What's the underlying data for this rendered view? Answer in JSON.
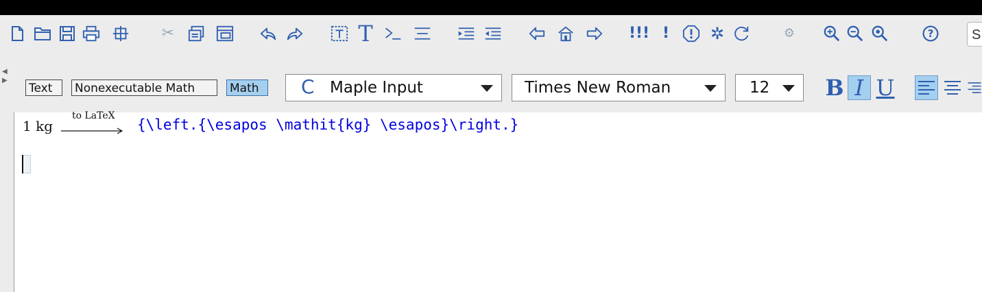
{
  "toolbar": {
    "icons": [
      {
        "name": "new-document-icon"
      },
      {
        "name": "open-folder-icon"
      },
      {
        "name": "save-icon"
      },
      {
        "name": "print-icon"
      },
      {
        "name": "print-preview-icon"
      },
      {
        "name": "cut-icon"
      },
      {
        "name": "copy-icon"
      },
      {
        "name": "paste-icon"
      },
      {
        "name": "undo-icon"
      },
      {
        "name": "redo-icon"
      },
      {
        "name": "insert-text-icon"
      },
      {
        "name": "insert-execution-group-icon"
      },
      {
        "name": "insert-section-icon"
      },
      {
        "name": "outdent-section-icon"
      },
      {
        "name": "indent-section-icon"
      },
      {
        "name": "back-icon"
      },
      {
        "name": "home-icon"
      },
      {
        "name": "forward-icon"
      },
      {
        "name": "execute-all-icon"
      },
      {
        "name": "execute-icon"
      },
      {
        "name": "interrupt-icon"
      },
      {
        "name": "debugger-icon"
      },
      {
        "name": "restart-icon"
      },
      {
        "name": "settings-icon"
      },
      {
        "name": "zoom-in-icon"
      },
      {
        "name": "zoom-out-icon"
      },
      {
        "name": "zoom-fit-icon"
      },
      {
        "name": "help-icon"
      }
    ],
    "execute_all_glyph": "!!!",
    "execute_glyph": "!",
    "text_glyph": "T",
    "help_glyph": "?",
    "search_text": "S"
  },
  "format_bar": {
    "modes": {
      "text": "Text",
      "nonexecutable_math": "Nonexecutable Math",
      "math": "Math"
    },
    "input_mode": {
      "prefix_icon": "C",
      "value": "Maple Input"
    },
    "font_family": {
      "value": "Times New Roman"
    },
    "font_size": {
      "value": "12"
    },
    "bold": "B",
    "italic": "I",
    "underline": "U"
  },
  "document": {
    "input_expression": "1 kg",
    "arrow_label": "to LaTeX",
    "output_latex": "{\\left.{\\esapos \\mathit{kg} \\esapos}\\right.}"
  },
  "colors": {
    "accent_blue": "#2f5fb0",
    "output_blue": "#0000e0",
    "active_mode_bg": "#a5cfef"
  }
}
